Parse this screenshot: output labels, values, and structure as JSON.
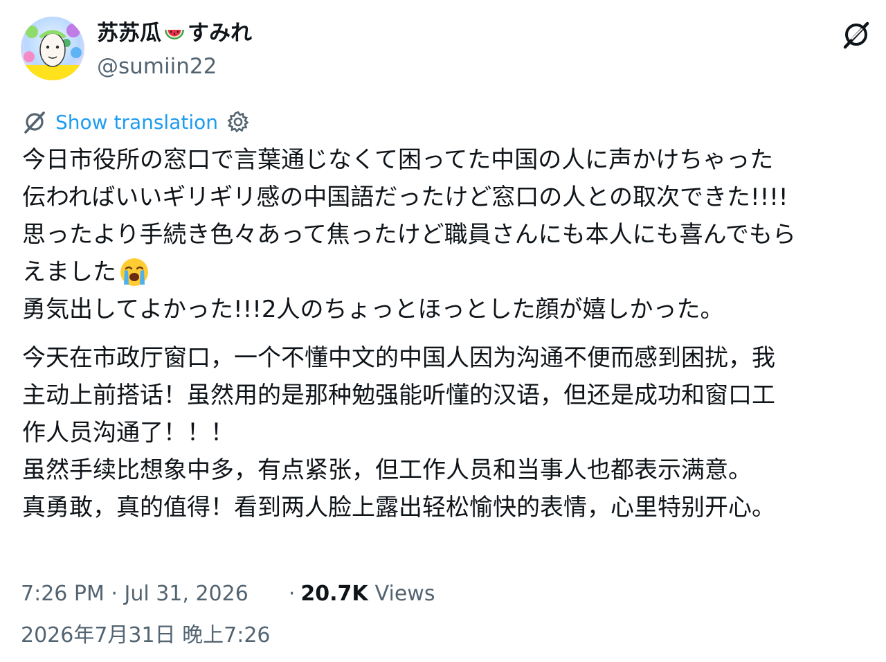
{
  "author": {
    "name_prefix": "苏苏瓜",
    "name_suffix": "すみれ",
    "name_emoji": "watermelon-icon",
    "handle": "@sumiin22"
  },
  "header": {
    "grok_icon": "grok-icon"
  },
  "translation": {
    "label": "Show translation",
    "icon": "grok-icon",
    "settings_icon": "gear-icon"
  },
  "tweet": {
    "lines": [
      "今日市役所の窓口で言葉通じなくて困ってた中国の人に声かけちゃった",
      "伝わればいいギリギリ感の中国語だったけど窓口の人との取次できた!!!!",
      "思ったより手続き色々あって焦ったけど職員さんにも本人にも喜んでもら",
      "えました",
      "勇気出してよかった!!!2人のちょっとほっとした顔が嬉しかった。"
    ],
    "emoji": "crying-face-icon"
  },
  "translated": {
    "lines": [
      "今天在市政厅窗口，一个不懂中文的中国人因为沟通不便而感到困扰，我",
      "主动上前搭话！虽然用的是那种勉强能听懂的汉语，但还是成功和窗口工",
      "作人员沟通了！！！",
      "虽然手续比想象中多，有点紧张，但工作人员和当事人也都表示满意。",
      "真勇敢，真的值得！看到两人脸上露出轻松愉快的表情，心里特别开心。"
    ]
  },
  "meta": {
    "time": "7:26 PM · Jul 31, 2026",
    "dot": "·",
    "views_count": "20.7K",
    "views_label": "Views",
    "local_time": "2026年7月31日 晚上7:26"
  },
  "colors": {
    "link": "#1d9bf0",
    "secondary": "#536471",
    "text": "#0f1419"
  }
}
